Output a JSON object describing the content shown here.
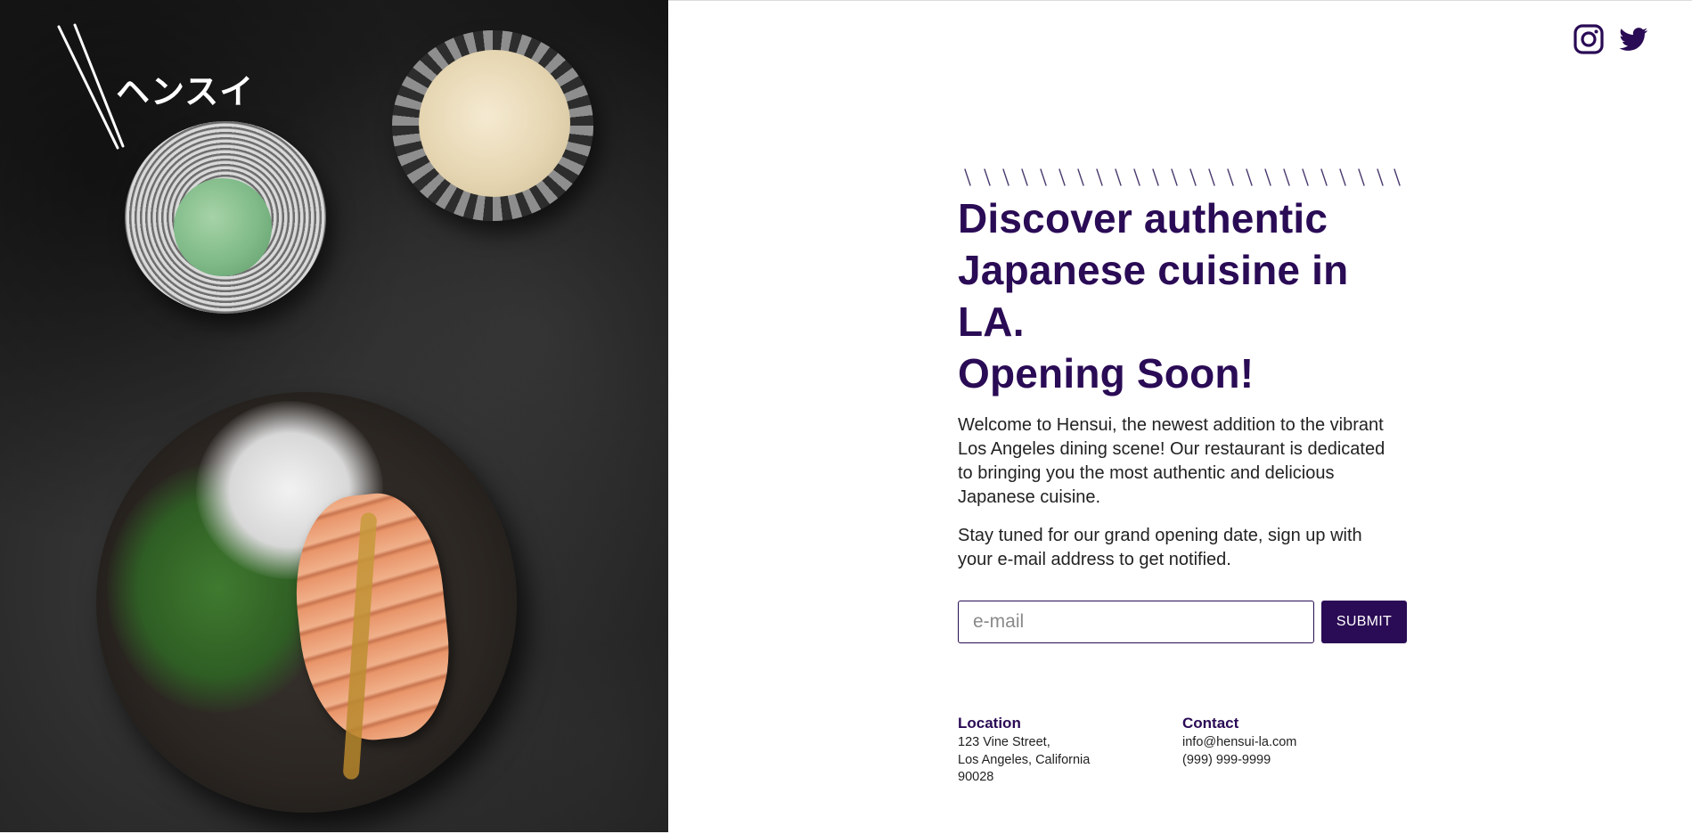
{
  "brand": {
    "logo_text": "ヘンスイ"
  },
  "social": {
    "icons": [
      "instagram-icon",
      "twitter-icon"
    ]
  },
  "hero": {
    "headline_line1": "Discover authentic",
    "headline_line2": "Japanese cuisine in LA.",
    "headline_line3": "Opening Soon!",
    "paragraph1": "Welcome to Hensui, the newest addition to the vibrant Los Angeles dining scene! Our restaurant is dedicated to bringing you the most authentic and delicious Japanese cuisine.",
    "paragraph2": "Stay tuned for our grand opening date, sign up with your e-mail address to get notified."
  },
  "signup": {
    "email_placeholder": "e-mail",
    "email_value": "",
    "submit_label": "SUBMIT"
  },
  "location": {
    "heading": "Location",
    "line1": "123 Vine Street,",
    "line2": "Los Angeles, California",
    "line3": "90028"
  },
  "contact": {
    "heading": "Contact",
    "email": "info@hensui-la.com",
    "phone": "(999) 999-9999"
  },
  "colors": {
    "accent": "#2a0b55",
    "background": "#ffffff"
  }
}
